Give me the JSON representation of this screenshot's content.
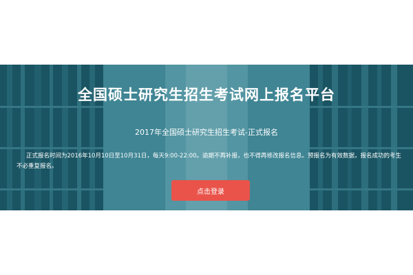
{
  "header": {
    "title": "全国硕士研究生招生考试网上报名平台",
    "subtitle": "2017年全国硕士研究生招生考试-正式报名"
  },
  "notice": {
    "text": "正式报名时间为2016年10月10日至10月31日，每天9:00-22:00。逾期不再补报，也不得再修改报名信息。预报名为有效数据，报名成功的考生不必重复报名。"
  },
  "actions": {
    "login_label": "点击登录"
  },
  "colors": {
    "banner_tint": "#2f6a76",
    "login_button": "#e9534a",
    "text": "#ffffff"
  }
}
